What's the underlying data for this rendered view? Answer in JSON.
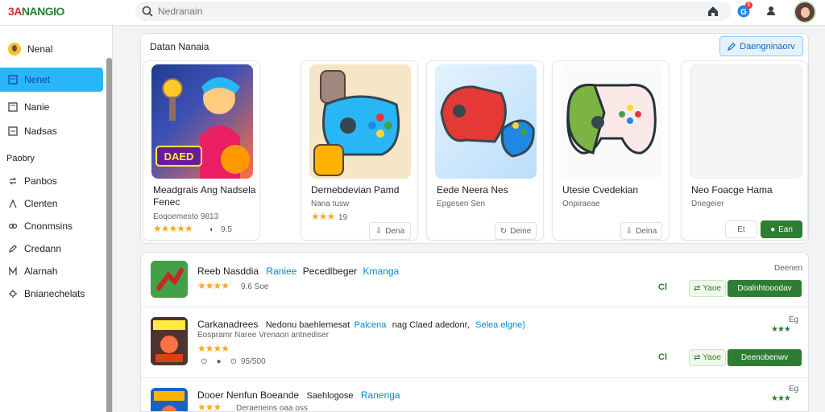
{
  "app": {
    "logo_text": "NANGIO",
    "logo_prefix": "3A"
  },
  "search": {
    "placeholder": "Nedranain"
  },
  "topbar": {
    "notification_count": "6"
  },
  "sidebar": {
    "user": "Nenal",
    "items": [
      {
        "label": "Nenet",
        "active": true
      },
      {
        "label": "Nanie",
        "active": false
      },
      {
        "label": "Nadsas",
        "active": false
      }
    ],
    "section_title": "Paobry",
    "section_items": [
      {
        "label": "Panbos"
      },
      {
        "label": "Clenten"
      },
      {
        "label": "Cnonmsins"
      },
      {
        "label": "Credann"
      },
      {
        "label": "Alarnah"
      },
      {
        "label": "Bnianechelats"
      }
    ]
  },
  "featured": {
    "title": "Datan Nanaia",
    "button_label": "Daengninaorv",
    "cards": [
      {
        "name": "Meadgrais Ang Nadsela Fenec",
        "meta": "Eoqoemesto 9813",
        "rating": 4.5,
        "reviews": "9.5",
        "action": ""
      },
      {
        "name": "Dernebdevian Pamd",
        "meta": "Nana tusw",
        "rating": 3,
        "reviews": "19",
        "action": "Dena"
      },
      {
        "name": "Eede Neera Nes",
        "meta": "Epgesen Sen",
        "rating": 0,
        "reviews": "",
        "action": "Deine"
      },
      {
        "name": "Utesie Cvedekian",
        "meta": "Onpiraeae",
        "rating": 0,
        "reviews": "",
        "action": "Deina"
      },
      {
        "name": "Neo Foacge Hama",
        "meta": "Dnegeier",
        "rating": 0,
        "reviews": "",
        "action": "Ean",
        "secondary": "Et"
      }
    ]
  },
  "list": {
    "rows": [
      {
        "title": "Reeb Nasddia",
        "tag": "Raniee",
        "middle": "Pecedlbeger",
        "tag2": "Kmanga",
        "rating": 4,
        "stats": "9.6 Soe",
        "right_label": "Deenen",
        "badge": "Cl",
        "small_btn": "Yaoe",
        "big_btn": "Doalnhtooodav"
      },
      {
        "title": "Carkanadrees",
        "tag": "",
        "middle": "Nedonu baehlemesat",
        "tag2": "Palcena",
        "extra": "nag Claed adedonr,",
        "tag3": "Selea elgne)",
        "sub": "Eospramr Naree Vrenaon antnediser",
        "rating": 4,
        "stats": "95/500",
        "right_label": "Eg",
        "badge": "Cl",
        "small_btn": "Yaoe",
        "big_btn": "Deenobenwv"
      },
      {
        "title": "Dooer Nenfun Boeande",
        "middle": "Saehlogose",
        "tag2": "Ranenga",
        "sub": "Deraeneins oaa oss",
        "rating": 3,
        "right_label": "Eg"
      }
    ]
  },
  "colors": {
    "accent_blue": "#29b6f6",
    "brand_green": "#2e7d32",
    "star": "#f9a825",
    "link_blue": "#0288d1"
  }
}
